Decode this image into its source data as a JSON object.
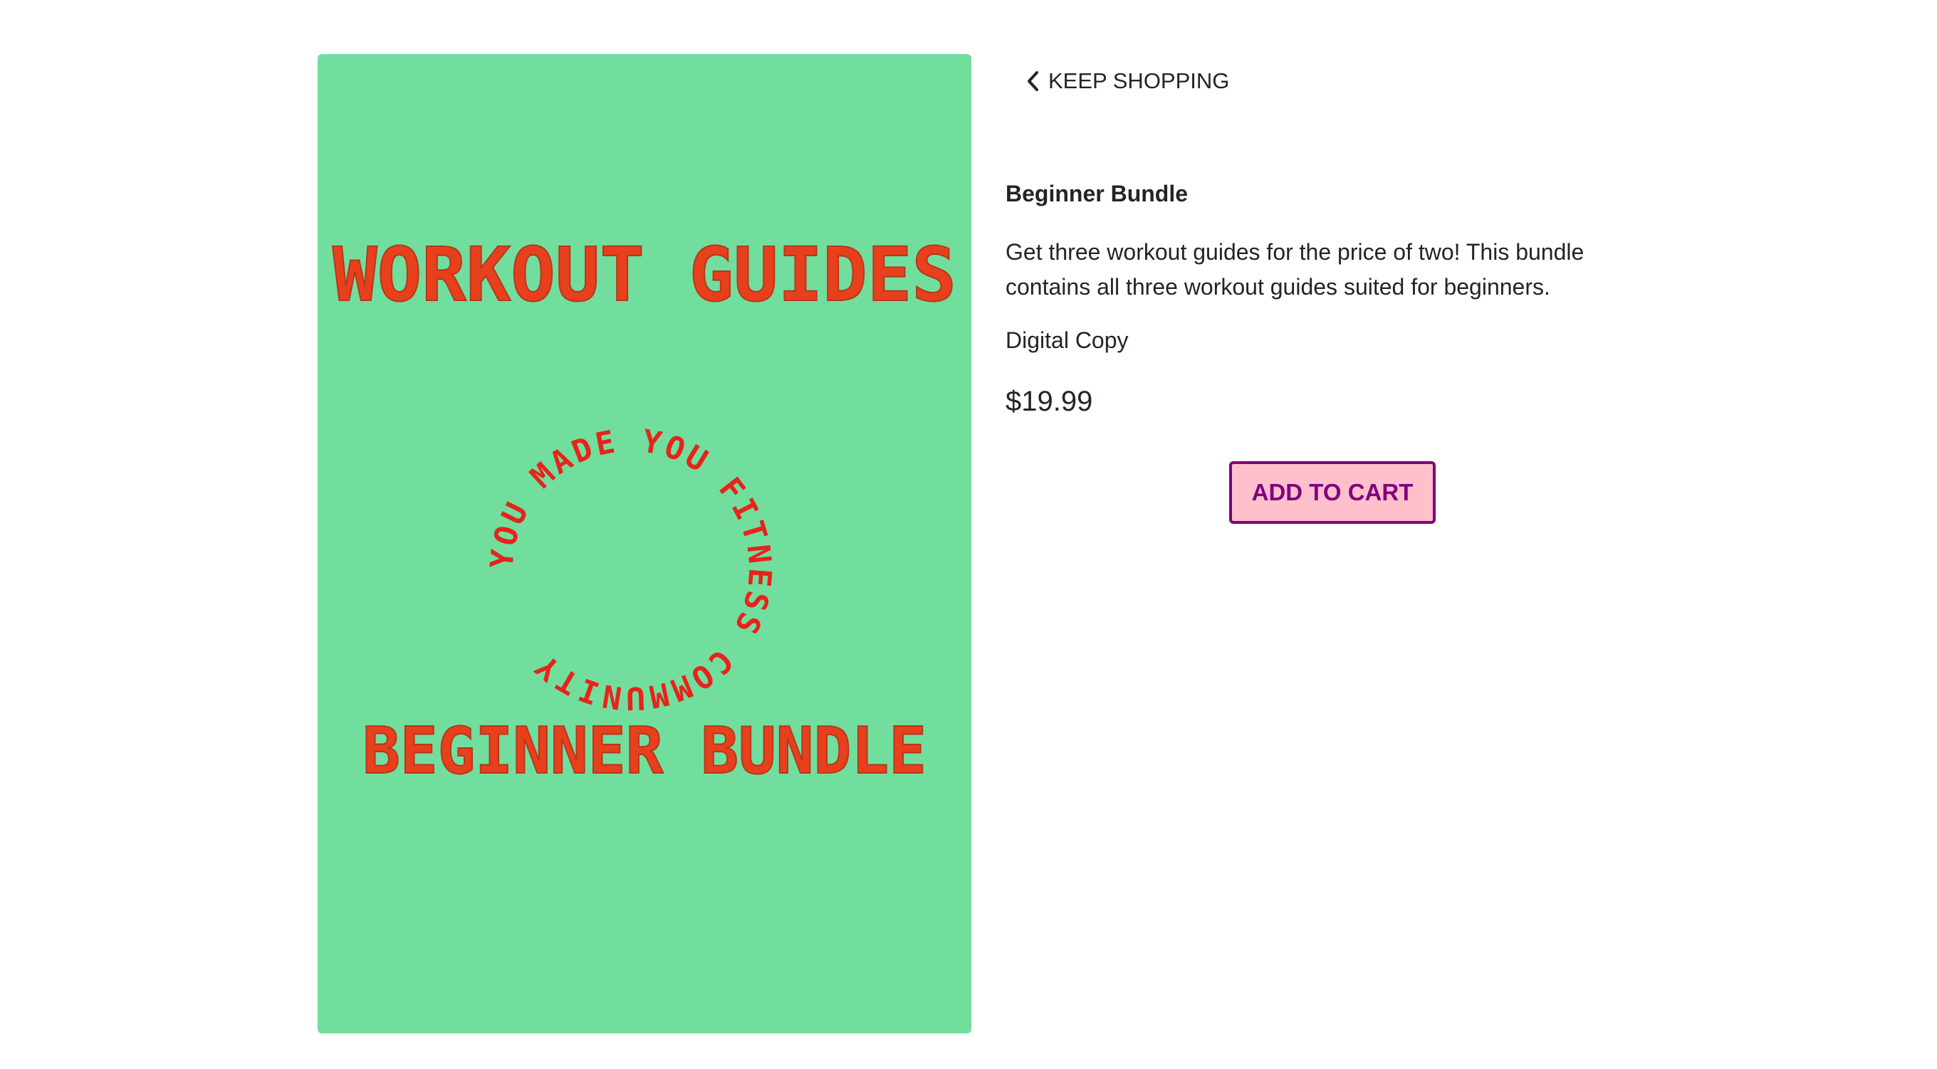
{
  "nav": {
    "back_label": "KEEP SHOPPING",
    "back_icon": "chevron-left-icon"
  },
  "cover": {
    "headline_top": "WORKOUT GUIDES",
    "ring_text": "YOU MADE YOU FITNESS COMMUNITY",
    "headline_bottom": "BEGINNER BUNDLE",
    "background_color": "#71de9e",
    "headline_color": "#e8401c",
    "ring_color": "#e8231a"
  },
  "product": {
    "title": "Beginner Bundle",
    "description": "Get three workout guides for the price of two! This bundle contains all three workout guides suited for beginners.",
    "format": "Digital Copy",
    "price": "$19.99"
  },
  "actions": {
    "add_to_cart_label": "ADD TO CART",
    "button_bg": "#ffc0cb",
    "button_color": "#800080"
  }
}
